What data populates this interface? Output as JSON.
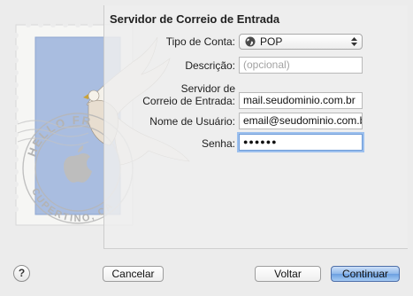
{
  "dialog": {
    "title": "Servidor de Correio de Entrada"
  },
  "stamp": {
    "postmark_top": "HELLO FR",
    "postmark_bottom": "CUPERTINO, CA"
  },
  "form": {
    "account_type": {
      "label": "Tipo de Conta:",
      "value": "POP"
    },
    "description": {
      "label": "Descrição:",
      "placeholder": "(opcional)"
    },
    "server": {
      "label_line1": "Servidor de",
      "label_line2": "Correio de Entrada:",
      "value": "mail.seudominio.com.br"
    },
    "username": {
      "label": "Nome de Usuário:",
      "value": "email@seudominio.com.br"
    },
    "password": {
      "label": "Senha:",
      "value": "●●●●●●"
    }
  },
  "buttons": {
    "help": "?",
    "cancel": "Cancelar",
    "back": "Voltar",
    "continue": "Continuar"
  },
  "colors": {
    "accent": "#6e9bd8",
    "stamp_blue": "#a9bde0",
    "window_bg": "#ececec"
  }
}
